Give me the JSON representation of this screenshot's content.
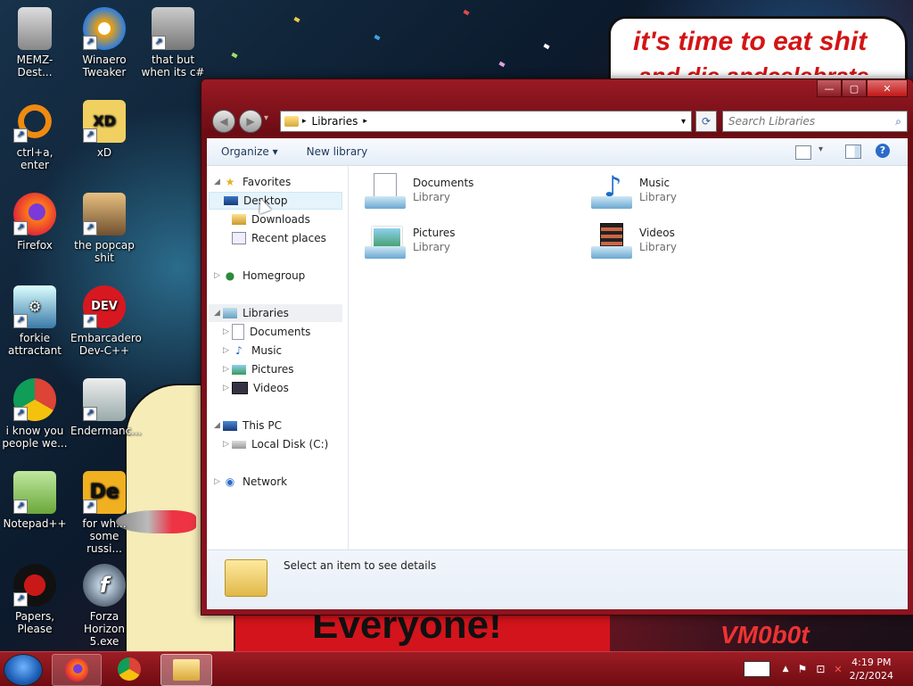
{
  "desktop": {
    "icons": [
      {
        "label": "MEMZ-Dest..."
      },
      {
        "label": "Winaero Tweaker"
      },
      {
        "label": "that but when its c#"
      },
      {
        "label": "ctrl+a, enter"
      },
      {
        "label": "xD"
      },
      {
        "label": "Firefox"
      },
      {
        "label": "the popcap shit"
      },
      {
        "label": "forkie attractant"
      },
      {
        "label": "Embarcadero Dev-C++"
      },
      {
        "label": "i know you people we..."
      },
      {
        "label": "Endermanc..."
      },
      {
        "label": "Notepad++"
      },
      {
        "label": "for wh... some russi..."
      },
      {
        "label": "Papers, Please"
      },
      {
        "label": "Forza Horizon 5.exe"
      }
    ],
    "wallpaper_text": {
      "speech_line1": "it's time to eat shit",
      "speech_line2": "and die andcelebrate",
      "banner": "Everyone!",
      "corner": "VM0b0t"
    }
  },
  "window": {
    "controls": {
      "minimize": "—",
      "maximize": "▢",
      "close": "✕"
    },
    "nav": {
      "back": "◀",
      "forward": "▶",
      "recent": "▾"
    },
    "address": {
      "separator": "▸",
      "location": "Libraries",
      "trail": "▸",
      "dropdown": "▾"
    },
    "refresh": "⟳",
    "search": {
      "placeholder": "Search Libraries"
    },
    "toolbar": {
      "organize": "Organize ▾",
      "new_library": "New library",
      "view_dropdown": "▾",
      "help": "?"
    },
    "nav_pane": {
      "favorites": "Favorites",
      "desktop": "Desktop",
      "downloads": "Downloads",
      "recent_places": "Recent places",
      "homegroup": "Homegroup",
      "libraries": "Libraries",
      "lib_documents": "Documents",
      "lib_music": "Music",
      "lib_pictures": "Pictures",
      "lib_videos": "Videos",
      "this_pc": "This PC",
      "local_disk": "Local Disk (C:)",
      "network": "Network"
    },
    "libraries": [
      {
        "name": "Documents",
        "type": "Library"
      },
      {
        "name": "Music",
        "type": "Library"
      },
      {
        "name": "Pictures",
        "type": "Library"
      },
      {
        "name": "Videos",
        "type": "Library"
      }
    ],
    "details": {
      "text": "Select an item to see details"
    }
  },
  "taskbar": {
    "time": "4:19 PM",
    "date": "2/2/2024",
    "tray": {
      "up_arrow": "▲",
      "flag": "⚑",
      "network": "⊡",
      "volume": "✕"
    }
  },
  "colors": {
    "accent": "#8c1420",
    "taskbar": "#7e1016",
    "nav_selected": "#e5f3fb",
    "link": "#1e395b"
  }
}
